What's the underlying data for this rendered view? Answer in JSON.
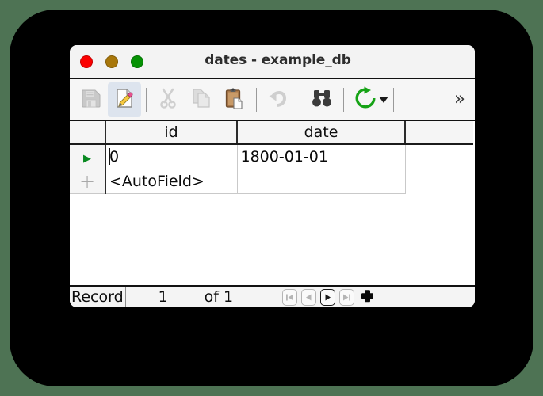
{
  "window": {
    "title": "dates - example_db",
    "traffic_lights": [
      {
        "name": "close",
        "color": "#fb0000"
      },
      {
        "name": "minimize",
        "color": "#a8770b"
      },
      {
        "name": "maximize",
        "color": "#069205"
      }
    ]
  },
  "toolbar": {
    "items": [
      {
        "icon": "save-icon",
        "label": "Save",
        "state": "disabled"
      },
      {
        "icon": "edit-record-icon",
        "label": "Edit Record",
        "state": "active"
      },
      {
        "icon": "cut-icon",
        "label": "Cut",
        "state": "disabled"
      },
      {
        "icon": "copy-icon",
        "label": "Copy",
        "state": "disabled"
      },
      {
        "icon": "paste-icon",
        "label": "Paste",
        "state": "enabled"
      },
      {
        "icon": "undo-icon",
        "label": "Undo",
        "state": "disabled"
      },
      {
        "icon": "find-icon",
        "label": "Find",
        "state": "enabled"
      },
      {
        "icon": "refresh-icon",
        "label": "Refresh",
        "state": "enabled"
      },
      {
        "icon": "dropdown-caret-icon",
        "label": "Refresh options",
        "state": "enabled"
      }
    ],
    "overflow_label": "»"
  },
  "grid": {
    "columns": [
      "",
      "id",
      "date",
      ""
    ],
    "rows": [
      {
        "marker": "▶",
        "marker_name": "current-record-arrow",
        "cells": [
          "0",
          "1800-01-01"
        ],
        "editing": true
      },
      {
        "marker": "+",
        "marker_name": "new-record-plus",
        "cells": [
          "<AutoField>",
          ""
        ],
        "editing": false
      }
    ]
  },
  "statusbar": {
    "record_label": "Record",
    "record_number": "1",
    "record_of": "of 1",
    "buttons": [
      {
        "name": "first-record-button",
        "glyph": "first",
        "enabled": false
      },
      {
        "name": "previous-record-button",
        "glyph": "previous",
        "enabled": false
      },
      {
        "name": "next-record-button",
        "glyph": "next",
        "enabled": true
      },
      {
        "name": "last-record-button",
        "glyph": "last",
        "enabled": false
      },
      {
        "name": "new-record-button",
        "glyph": "plus",
        "enabled": true
      }
    ]
  },
  "colors": {
    "desktop_background": "#4e7354",
    "backdrop": "#000000",
    "window_background": "#ffffff",
    "toolbar_background": "#f6f6f6",
    "active_tool_background": "#dde4ee",
    "record_arrow_green": "#0a8a22",
    "refresh_green": "#16a316"
  }
}
